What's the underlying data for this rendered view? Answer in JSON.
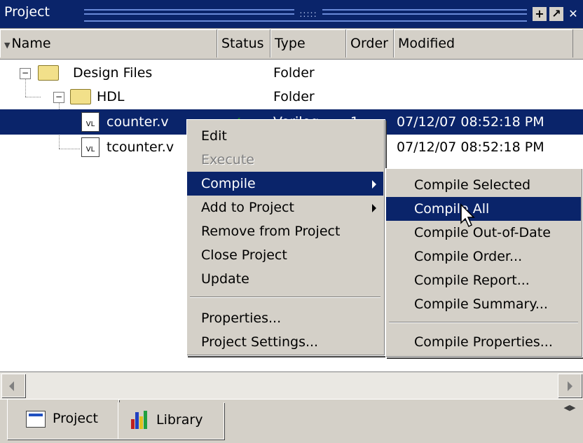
{
  "window": {
    "title": "Project"
  },
  "columns": [
    {
      "label": "Name"
    },
    {
      "label": "Status"
    },
    {
      "label": "Type"
    },
    {
      "label": "Order"
    },
    {
      "label": "Modified"
    }
  ],
  "tree": [
    {
      "name": "Design Files",
      "type": "Folder",
      "order": "",
      "modified": ""
    },
    {
      "name": "HDL",
      "type": "Folder",
      "order": "",
      "modified": ""
    },
    {
      "name": "counter.v",
      "type": "Verilog",
      "order": "1",
      "modified": "07/12/07 08:52:18 PM",
      "selected": true
    },
    {
      "name": "tcounter.v",
      "type": "",
      "order": "",
      "modified": "07/12/07 08:52:18 PM"
    }
  ],
  "file_icon_text": "VL",
  "context_menu": {
    "items": [
      {
        "label": "Edit",
        "enabled": true
      },
      {
        "label": "Execute",
        "enabled": false
      },
      {
        "label": "Compile",
        "enabled": true,
        "submenu": true,
        "highlighted": true
      },
      {
        "label": "Add to Project",
        "enabled": true,
        "submenu": true
      },
      {
        "label": "Remove from Project",
        "enabled": true
      },
      {
        "label": "Close Project",
        "enabled": true
      },
      {
        "label": "Update",
        "enabled": true
      },
      {
        "label": "Properties...",
        "enabled": true
      },
      {
        "label": "Project Settings...",
        "enabled": true
      }
    ]
  },
  "submenu": {
    "items": [
      {
        "label": "Compile Selected"
      },
      {
        "label": "Compile All",
        "highlighted": true
      },
      {
        "label": "Compile Out-of-Date"
      },
      {
        "label": "Compile Order..."
      },
      {
        "label": "Compile Report..."
      },
      {
        "label": "Compile Summary..."
      },
      {
        "label": "Compile Properties..."
      }
    ]
  },
  "tabs": [
    {
      "label": "Project",
      "active": true
    },
    {
      "label": "Library",
      "active": false
    }
  ],
  "colors": {
    "selection": "#0a246a",
    "face": "#d4d0c8",
    "status_check": "#1a8a1a"
  }
}
